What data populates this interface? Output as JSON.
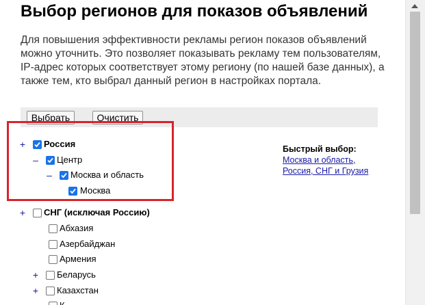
{
  "title": "Выбор регионов для показов объявлений",
  "description": "Для повышения эффективности рекламы регион показов объявлений можно уточнить. Это позволяет показывать рекламу тем пользователям, IP-адрес которых соответствует этому региону (по нашей базе данных), а также тем, кто выбрал данный регион в настройках портала.",
  "toolbar": {
    "select_label": "Выбрать",
    "clear_label": "Очистить"
  },
  "tree": {
    "russia": {
      "toggle": "+",
      "label": "Россия",
      "checked": true
    },
    "center": {
      "toggle": "–",
      "label": "Центр",
      "checked": true
    },
    "moscow_region": {
      "toggle": "–",
      "label": "Москва и область",
      "checked": true
    },
    "moscow": {
      "label": "Москва",
      "checked": true
    },
    "cis": {
      "toggle": "+",
      "label": "СНГ (исключая Россию)",
      "checked": false
    },
    "abkhazia": {
      "label": "Абхазия",
      "checked": false
    },
    "azerbaijan": {
      "label": "Азербайджан",
      "checked": false
    },
    "armenia": {
      "label": "Армения",
      "checked": false
    },
    "belarus": {
      "toggle": "+",
      "label": "Беларусь",
      "checked": false
    },
    "kazakhstan": {
      "toggle": "+",
      "label": "Казахстан",
      "checked": false
    },
    "next": {
      "label": "К",
      "checked": false
    }
  },
  "quick_select": {
    "title": "Быстрый выбор:",
    "link_1": "Москва и область,",
    "link_2": "Россия, СНГ и Грузия"
  },
  "colors": {
    "highlight": "#d9232b",
    "checkbox_checked": "#1a73e8",
    "link": "#1a1aa6"
  }
}
